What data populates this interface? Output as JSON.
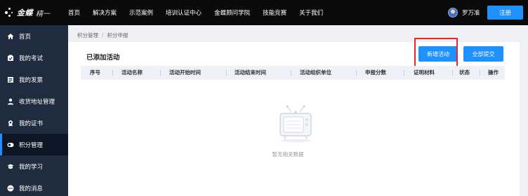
{
  "header": {
    "brand": "金蝶",
    "brand_sub": "精一",
    "nav": [
      "首页",
      "解决方案",
      "示范案例",
      "培训认证中心",
      "金蝶顾问学院",
      "技能竞赛",
      "关于我们"
    ],
    "user_name": "罗万准",
    "register_label": "注册"
  },
  "sidebar": {
    "items": [
      {
        "label": "首页",
        "icon": "home-icon"
      },
      {
        "label": "我的考试",
        "icon": "exam-icon"
      },
      {
        "label": "我的发票",
        "icon": "invoice-icon"
      },
      {
        "label": "收货地址管理",
        "icon": "address-icon"
      },
      {
        "label": "我的证书",
        "icon": "certificate-icon"
      },
      {
        "label": "积分管理",
        "icon": "points-icon"
      },
      {
        "label": "我的学习",
        "icon": "study-icon"
      },
      {
        "label": "我的消息",
        "icon": "message-icon"
      }
    ],
    "active_index": 5
  },
  "breadcrumb": {
    "items": [
      "积分管理",
      "积分申报"
    ],
    "separator": "/"
  },
  "main": {
    "section_title": "已添加活动",
    "add_button": "新增活动",
    "submit_all_button": "全部提交",
    "table": {
      "columns": [
        "序号",
        "活动名称",
        "活动开始时间",
        "活动结束时间",
        "活动组织单位",
        "申报分数",
        "证明材料",
        "状态",
        "操作"
      ],
      "rows": []
    },
    "empty_text": "暂无相关数据"
  },
  "colors": {
    "accent": "#1e90ff",
    "highlight": "#e8262b",
    "sidebar_bg": "#1f2b3e",
    "topbar_bg": "#0a0a0a"
  }
}
